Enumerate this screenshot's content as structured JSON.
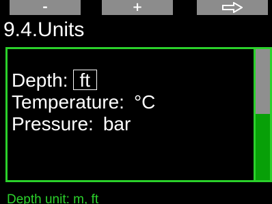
{
  "softkeys": {
    "left_label": "-",
    "middle_label": "+",
    "right_icon": "right-arrow-icon"
  },
  "title": "9.4.Units",
  "settings": [
    {
      "label": "Depth:",
      "value": "ft",
      "selected": true
    },
    {
      "label": "Temperature:",
      "value": "°C",
      "selected": false
    },
    {
      "label": "Pressure:",
      "value": "bar",
      "selected": false
    }
  ],
  "hint": "Depth unit: m, ft",
  "colors": {
    "accent": "#2bd12b",
    "softkey_bg": "#8c8c8c",
    "scroll_track": "#08a008",
    "scroll_thumb": "#8f8f8f",
    "background": "#000000"
  }
}
